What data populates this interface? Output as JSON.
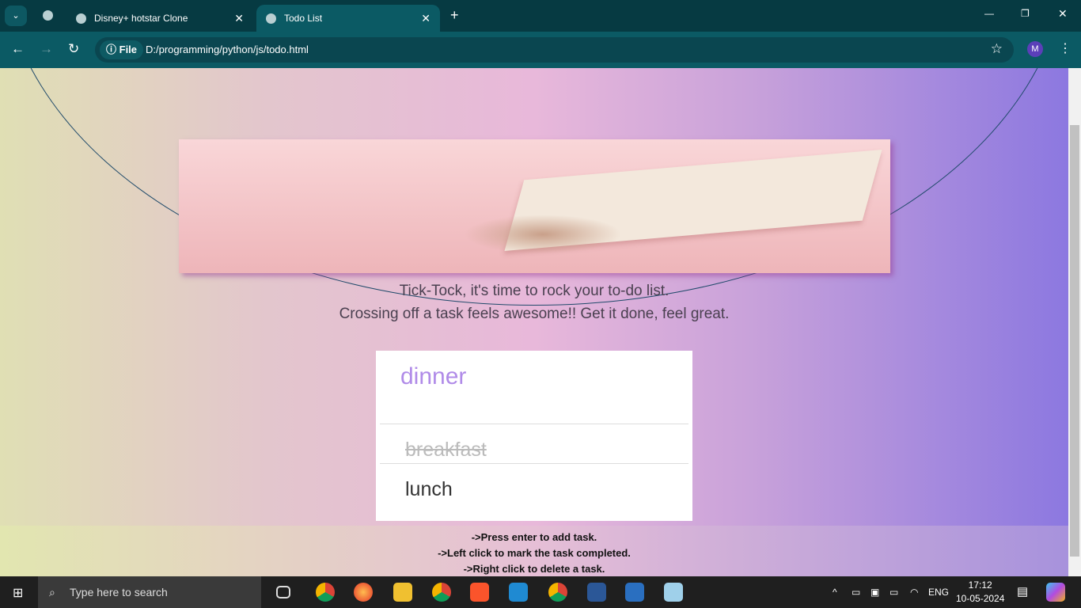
{
  "browser": {
    "tabs": [
      {
        "title": "Disney+ hotstar Clone",
        "active": false
      },
      {
        "title": "Todo List",
        "active": true
      }
    ],
    "address": {
      "scheme_label": "File",
      "url": "D:/programming/python/js/todo.html"
    },
    "profile_initial": "M"
  },
  "page": {
    "tagline_1": "Tick-Tock, it's time to rock your to-do list.",
    "tagline_2": "Crossing off a task feels awesome!! Get it done, feel great.",
    "input_value": "dinner",
    "tasks": [
      {
        "text": "breakfast",
        "completed": true
      },
      {
        "text": "lunch",
        "completed": false
      }
    ],
    "instructions": [
      "->Press enter to add task.",
      "->Left click to mark the task completed.",
      "->Right click to delete a task."
    ]
  },
  "taskbar": {
    "search_placeholder": "Type here to search",
    "language": "ENG",
    "time": "17:12",
    "date": "10-05-2024"
  }
}
